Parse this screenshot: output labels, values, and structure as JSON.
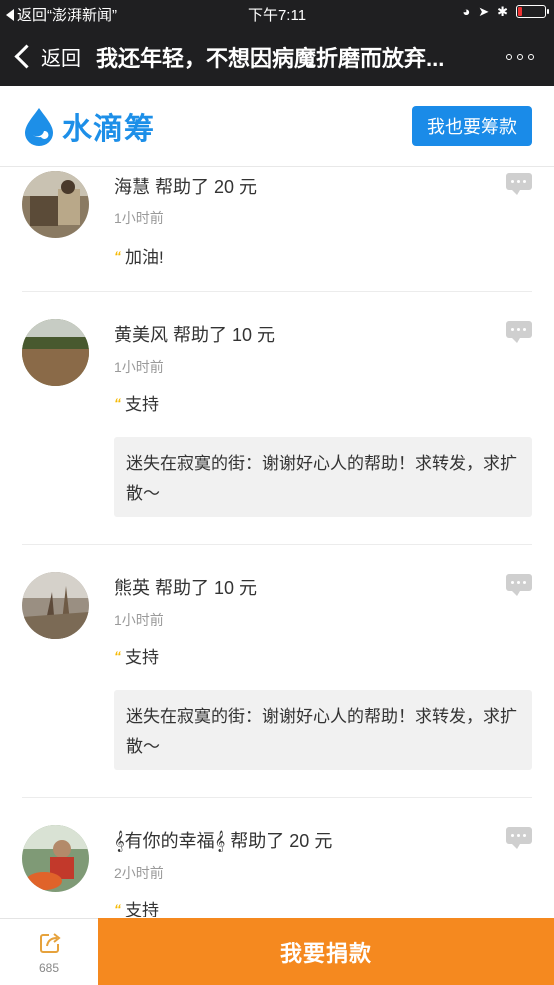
{
  "status_bar": {
    "back_app": "返回“澎湃新闻”",
    "time": "下午7:11",
    "battery_level_percent": 15
  },
  "nav": {
    "back_label": "返回",
    "title": "我还年轻，不想因病魔折磨而放弃..."
  },
  "brand": {
    "name": "水滴筹",
    "raise_button": "我也要筹款",
    "color": "#1d8fe8"
  },
  "feed": [
    {
      "name": "海慧",
      "action": "帮助了 20 元",
      "time": "1小时前",
      "message": "加油!",
      "reply": null
    },
    {
      "name": "黄美风",
      "action": "帮助了 10 元",
      "time": "1小时前",
      "message": "支持",
      "reply": "迷失在寂寞的街：谢谢好心人的帮助！求转发，求扩散～"
    },
    {
      "name": "熊英",
      "action": "帮助了 10 元",
      "time": "1小时前",
      "message": "支持",
      "reply": "迷失在寂寞的街：谢谢好心人的帮助！求转发，求扩散～"
    },
    {
      "name": "𝄞有你的幸福𝄞",
      "action": "帮助了 20 元",
      "time": "2小时前",
      "message": "支持",
      "reply": null
    }
  ],
  "bottom_bar": {
    "share_count": "685",
    "donate_button": "我要捐款",
    "donate_color": "#f5891f"
  }
}
